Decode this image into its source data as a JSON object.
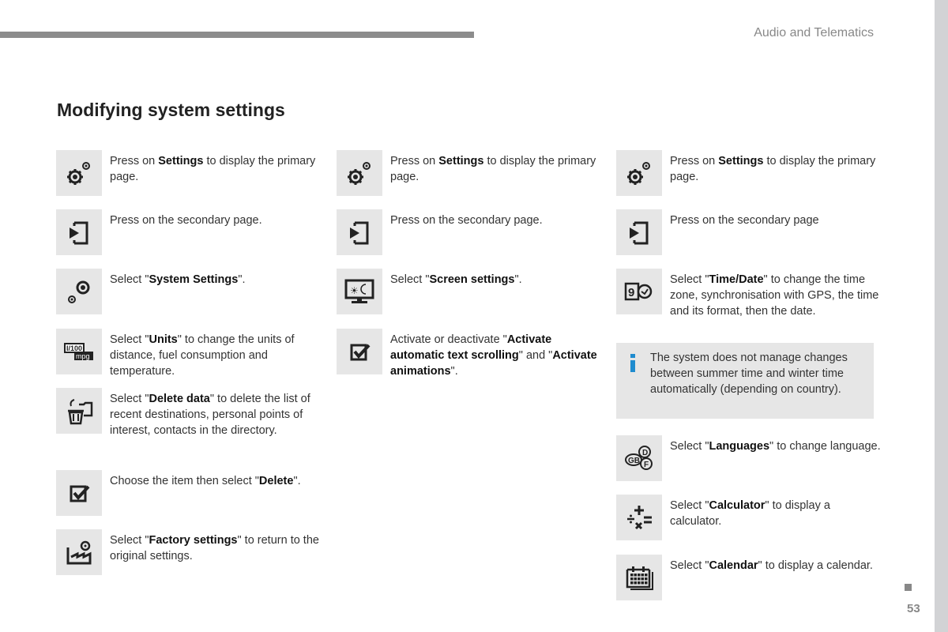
{
  "header": {
    "section": "Audio and Telematics"
  },
  "title": "Modifying system settings",
  "columns": [
    [
      {
        "icon": "settings-icon",
        "pre": "Press on ",
        "bold": "Settings",
        "post": " to display the primary page."
      },
      {
        "icon": "secondary-page-icon",
        "pre": "Press on the secondary page.",
        "bold": "",
        "post": ""
      },
      {
        "icon": "system-settings-icon",
        "pre": "Select \"",
        "bold": "System Settings",
        "post": "\"."
      },
      {
        "icon": "units-icon",
        "pre": "Select \"",
        "bold": "Units",
        "post": "\" to change the units of distance, fuel consumption and temperature."
      },
      {
        "icon": "delete-data-icon",
        "pre": "Select \"",
        "bold": "Delete data",
        "post": "\" to delete the list of recent destinations, personal points of interest, contacts in the directory."
      },
      {
        "icon": "checkbox-icon",
        "pre": "Choose the item then select \"",
        "bold": "Delete",
        "post": "\"."
      },
      {
        "icon": "factory-settings-icon",
        "pre": "Select \"",
        "bold": "Factory settings",
        "post": "\" to return to the original settings."
      }
    ],
    [
      {
        "icon": "settings-icon",
        "pre": "Press on ",
        "bold": "Settings",
        "post": " to display the primary page."
      },
      {
        "icon": "secondary-page-icon",
        "pre": "Press on the secondary page.",
        "bold": "",
        "post": ""
      },
      {
        "icon": "screen-settings-icon",
        "pre": "Select \"",
        "bold": "Screen settings",
        "post": "\"."
      },
      {
        "icon": "checkbox-icon",
        "pre": "Activate or deactivate \"",
        "bold": "Activate automatic text scrolling",
        "post": "\" and \"",
        "bold2": "Activate animations",
        "post2": "\"."
      }
    ],
    [
      {
        "icon": "settings-icon",
        "pre": "Press on ",
        "bold": "Settings",
        "post": " to display the primary page."
      },
      {
        "icon": "secondary-page-icon",
        "pre": "Press on the secondary page",
        "bold": "",
        "post": ""
      },
      {
        "icon": "time-date-icon",
        "pre": "Select \"",
        "bold": "Time/Date",
        "post": "\" to change the time zone, synchronisation with GPS, the time and its format, then the date."
      },
      {
        "icon": "languages-icon",
        "pre": "Select \"",
        "bold": "Languages",
        "post": "\" to change language."
      },
      {
        "icon": "calculator-icon",
        "pre": "Select \"",
        "bold": "Calculator",
        "post": "\" to display a calculator."
      },
      {
        "icon": "calendar-icon",
        "pre": "Select \"",
        "bold": "Calendar",
        "post": "\" to display a calendar."
      }
    ]
  ],
  "info_note": "The system does not manage changes between summer time and winter time automatically (depending on country).",
  "colors": {
    "info_accent": "#1f8ccf",
    "icon_bg": "#e6e6e6"
  },
  "page_number": "53"
}
